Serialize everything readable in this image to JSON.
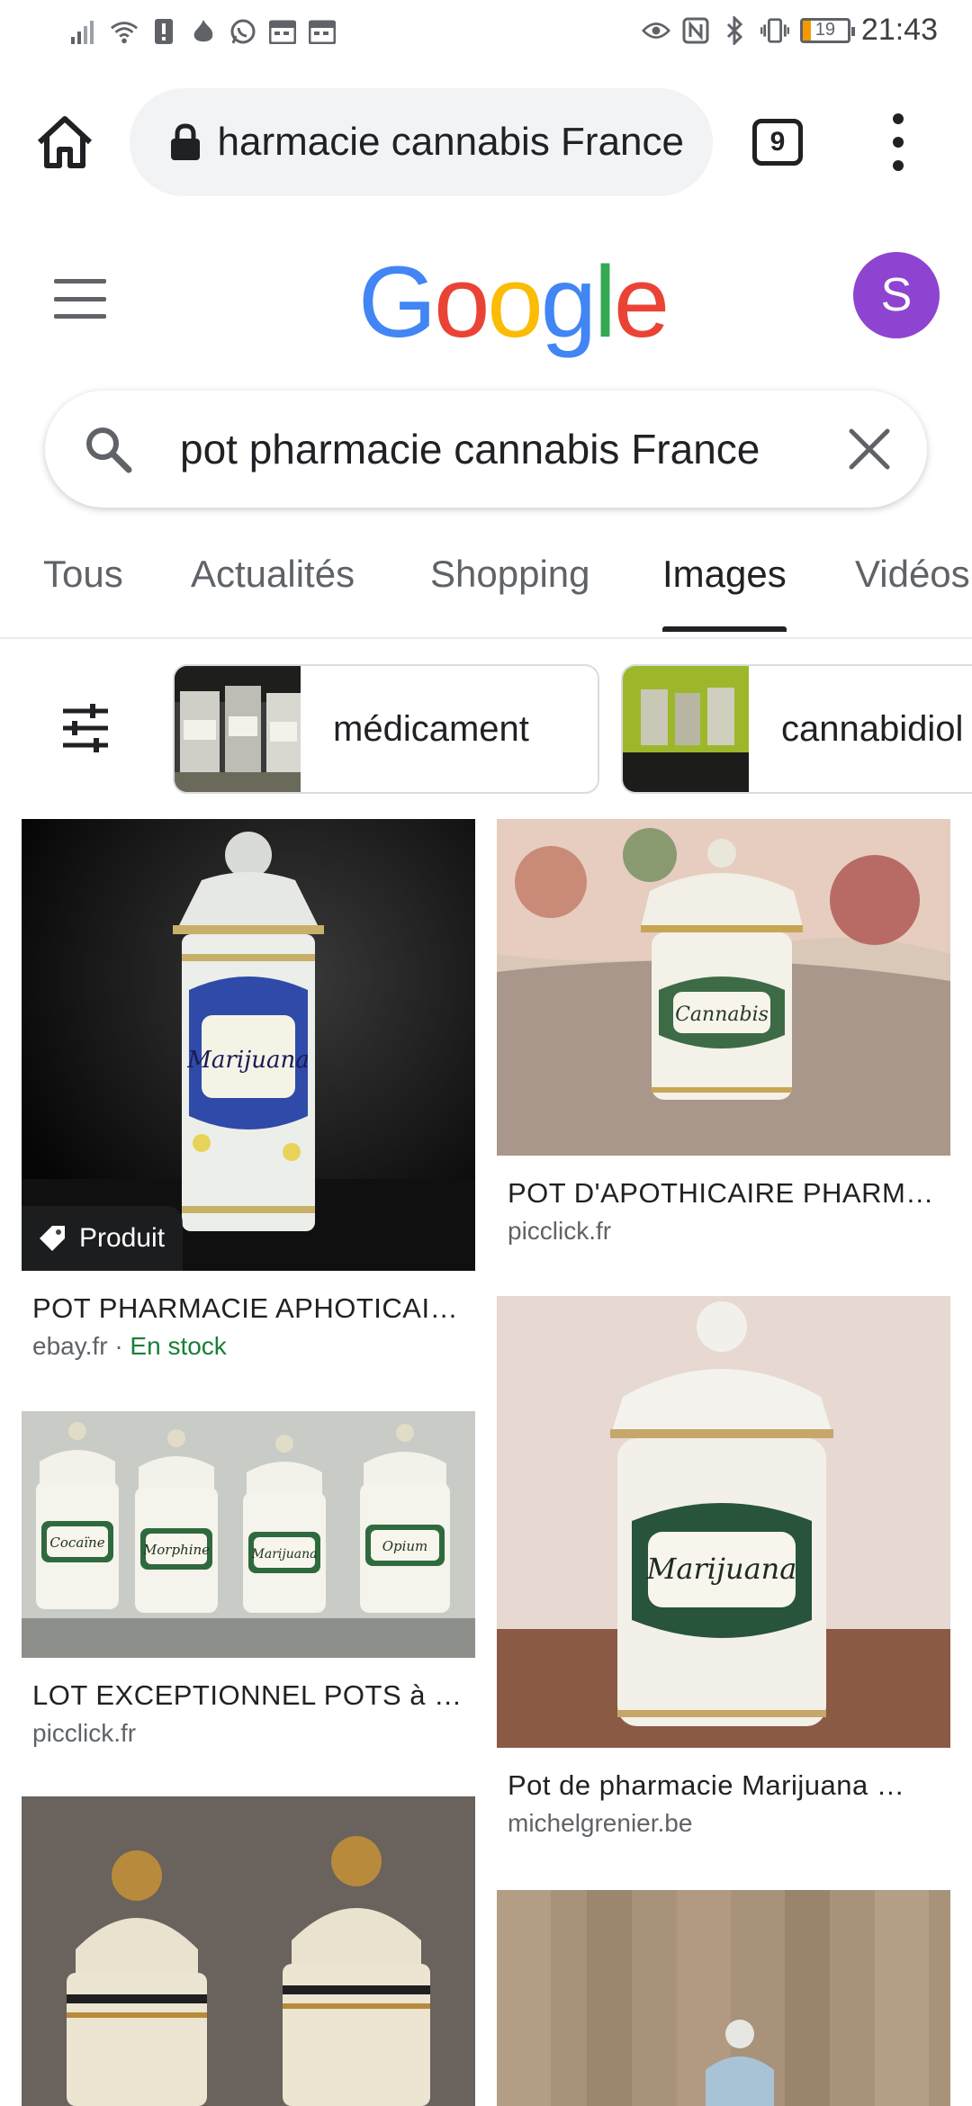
{
  "status_bar": {
    "time": "21:43",
    "battery_level": "19"
  },
  "browser": {
    "url_text": "pot pharmacie cannabis France",
    "tab_count": "9"
  },
  "google": {
    "logo_letters": [
      "G",
      "o",
      "o",
      "g",
      "l",
      "e"
    ],
    "logo_colors": [
      "#4285F4",
      "#EA4335",
      "#FBBC05",
      "#4285F4",
      "#34A853",
      "#EA4335"
    ],
    "avatar_initial": "S",
    "avatar_color": "#8E44D0"
  },
  "search": {
    "query": "pot pharmacie cannabis France"
  },
  "tabs": [
    "Tous",
    "Actualités",
    "Shopping",
    "Images",
    "Vidéos"
  ],
  "active_tab": "Images",
  "chips": [
    {
      "label": "médicament"
    },
    {
      "label": "cannabidiol"
    }
  ],
  "results": [
    {
      "title": "POT PHARMACIE APHOTICAI…",
      "source": "ebay.fr",
      "extra": "En stock",
      "badge": "Produit",
      "image_label": "Marijuana"
    },
    {
      "title": "POT D'APOTHICAIRE PHARM…",
      "source": "picclick.fr",
      "image_label": "Cannabis"
    },
    {
      "title": "LOT EXCEPTIONNEL POTS à …",
      "source": "picclick.fr",
      "image_labels": [
        "Cocaïne",
        "Morphine",
        "Marijuana",
        "Opium"
      ]
    },
    {
      "title": "Pot de pharmacie Marijuana …",
      "source": "michelgrenier.be",
      "image_label": "Marijuana"
    }
  ]
}
